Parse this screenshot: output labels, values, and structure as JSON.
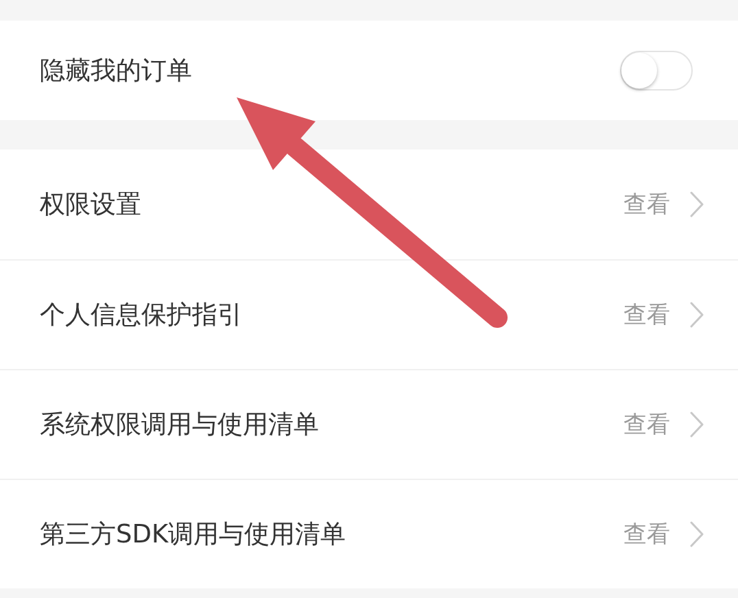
{
  "sections": [
    {
      "items": [
        {
          "kind": "toggle",
          "label": "隐藏我的订单",
          "on": false
        }
      ]
    },
    {
      "items": [
        {
          "kind": "link",
          "label": "权限设置",
          "action": "查看"
        },
        {
          "kind": "link",
          "label": "个人信息保护指引",
          "action": "查看"
        },
        {
          "kind": "link",
          "label": "系统权限调用与使用清单",
          "action": "查看"
        },
        {
          "kind": "link",
          "label": "第三方SDK调用与使用清单",
          "action": "查看"
        }
      ]
    }
  ],
  "annotations": [
    {
      "kind": "arrow"
    }
  ]
}
